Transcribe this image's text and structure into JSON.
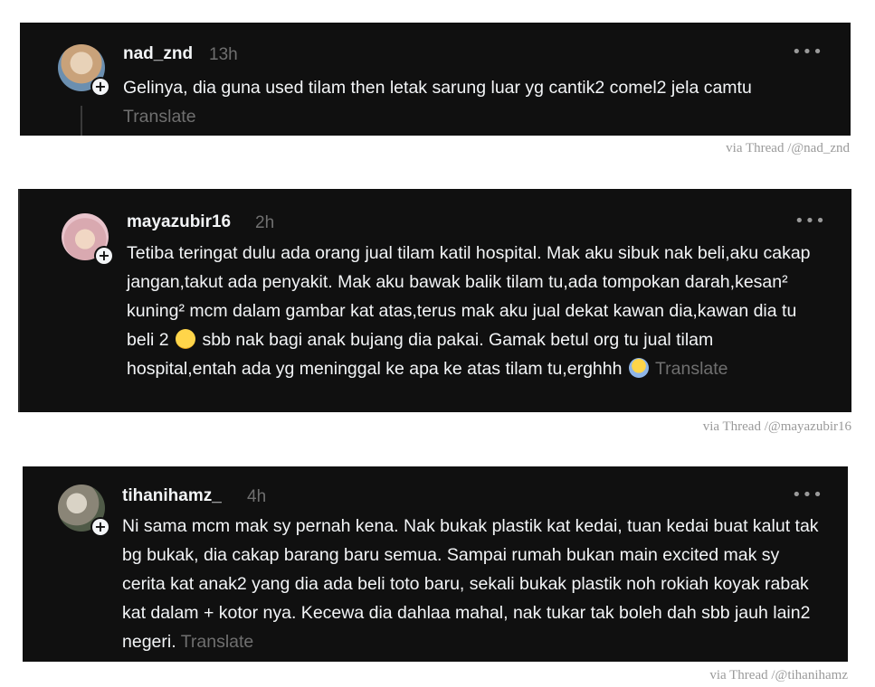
{
  "posts": [
    {
      "username": "nad_znd",
      "time": "13h",
      "more_icon": "more-dots-icon",
      "text": "Gelinya, dia guna used tilam then letak sarung luar yg cantik2 comel2 jela camtu",
      "translate": "Translate",
      "credit": "via Thread /@nad_znd"
    },
    {
      "username": "mayazubir16",
      "time": "2h",
      "more_icon": "more-dots-icon",
      "text_part1": "Tetiba teringat dulu ada orang jual tilam katil hospital. Mak aku sibuk nak beli,aku cakap jangan,takut ada penyakit. Mak aku bawak balik tilam tu,ada tompokan darah,kesan² kuning² mcm dalam gambar kat atas,terus mak aku jual dekat kawan dia,kawan dia tu beli 2",
      "text_part2": "sbb nak bagi anak bujang dia pakai. Gamak betul org tu jual tilam hospital,entah ada yg meninggal ke apa ke atas tilam tu,erghhh",
      "emoji1": "sweat-smile-emoji-icon",
      "emoji2": "screaming-face-emoji-icon",
      "translate": "Translate",
      "credit": "via Thread /@mayazubir16"
    },
    {
      "username": "tihanihamz_",
      "time": "4h",
      "more_icon": "more-dots-icon",
      "text": "Ni sama mcm mak sy pernah kena. Nak bukak plastik kat kedai, tuan kedai buat kalut tak bg bukak, dia cakap barang baru semua. Sampai rumah bukan main excited mak sy cerita kat anak2 yang dia ada beli toto baru, sekali bukak plastik noh rokiah koyak rabak kat dalam + kotor nya. Kecewa dia dahlaa mahal, nak tukar tak boleh dah sbb jauh lain2 negeri.",
      "translate": "Translate",
      "credit": "via Thread /@tihanihamz"
    }
  ],
  "colors": {
    "card_bg": "#101010",
    "text": "#f3f5f7",
    "muted": "#6f6f6f",
    "credit": "#9a9a9a"
  }
}
